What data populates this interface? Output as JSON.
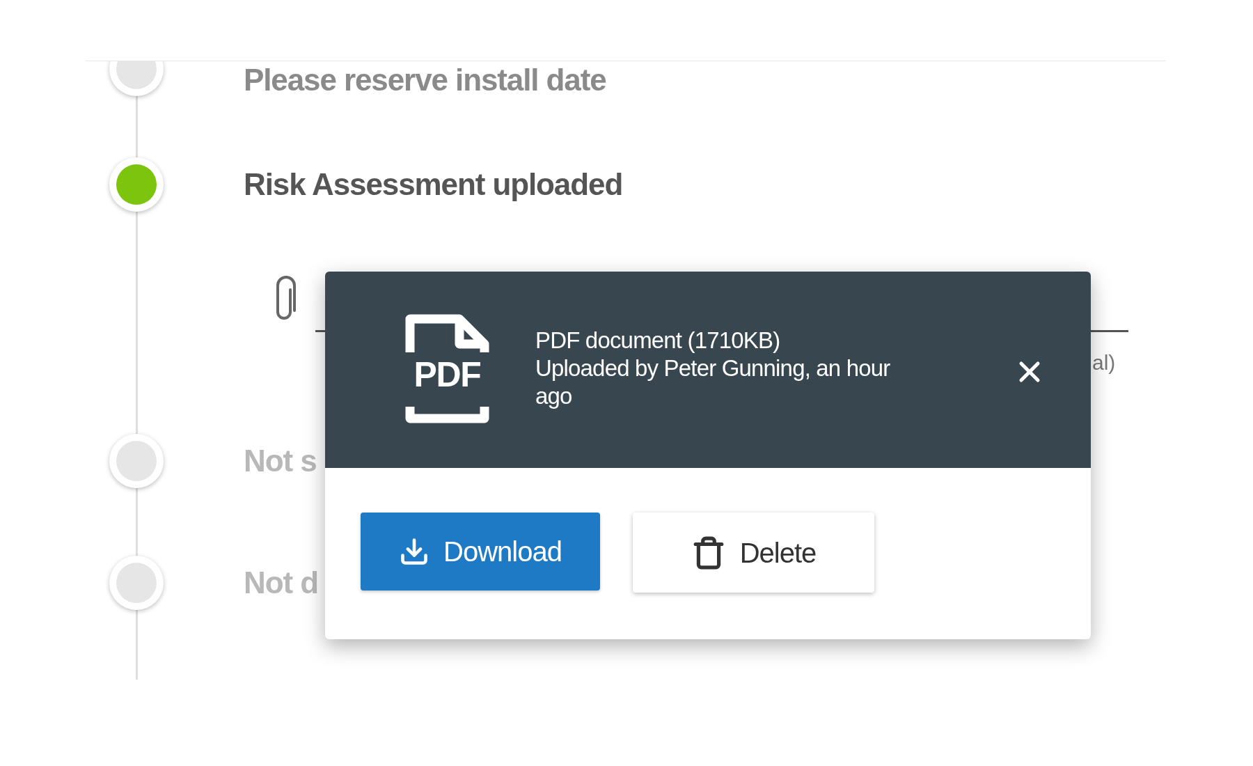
{
  "timeline": [
    {
      "label": "Please reserve install date",
      "completed": false,
      "disabled": false
    },
    {
      "label": "Risk Assessment uploaded",
      "completed": true,
      "disabled": false
    },
    {
      "label": "Not s",
      "completed": false,
      "disabled": true
    },
    {
      "label": "Not d",
      "completed": false,
      "disabled": true
    }
  ],
  "attachment_field": {
    "hint_fragment": "al)"
  },
  "popup": {
    "file_type": "PDF",
    "title": "PDF document (1710KB)",
    "detail": "Uploaded by Peter Gunning, an hour ago",
    "buttons": [
      {
        "label": "Download",
        "kind": "primary"
      },
      {
        "label": "Delete",
        "kind": "delete"
      }
    ]
  }
}
